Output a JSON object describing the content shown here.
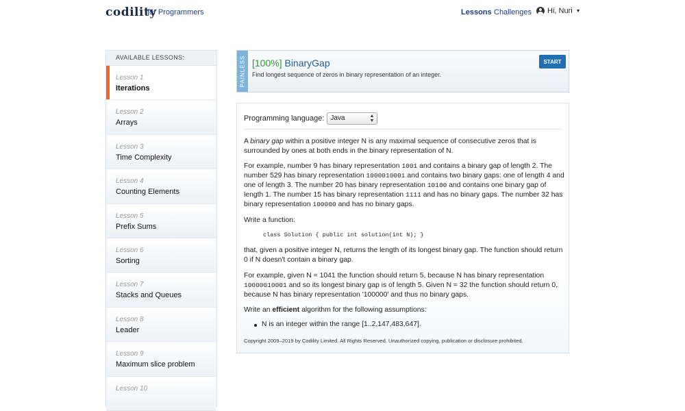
{
  "header": {
    "logo": "codility",
    "logo_sub": "for Programmers",
    "nav": {
      "lessons": "Lessons",
      "challenges": "Challenges"
    },
    "user": "Hi, Nuri"
  },
  "sidebar": {
    "header": "AVAILABLE LESSONS:",
    "items": [
      {
        "num": "Lesson 1",
        "title": "Iterations"
      },
      {
        "num": "Lesson 2",
        "title": "Arrays"
      },
      {
        "num": "Lesson 3",
        "title": "Time Complexity"
      },
      {
        "num": "Lesson 4",
        "title": "Counting Elements"
      },
      {
        "num": "Lesson 5",
        "title": "Prefix Sums"
      },
      {
        "num": "Lesson 6",
        "title": "Sorting"
      },
      {
        "num": "Lesson 7",
        "title": "Stacks and Queues"
      },
      {
        "num": "Lesson 8",
        "title": "Leader"
      },
      {
        "num": "Lesson 9",
        "title": "Maximum slice problem"
      },
      {
        "num": "Lesson 10",
        "title": ""
      }
    ]
  },
  "task": {
    "difficulty": "PAINLESS",
    "score": "[100%]",
    "name": "BinaryGap",
    "description": "Find longest sequence of zeros in binary representation of an integer.",
    "start_label": "START"
  },
  "content": {
    "language_label": "Programming language:",
    "language_value": "Java",
    "p1_a": "A ",
    "p1_em": "binary gap",
    "p1_b": " within a positive integer N is any maximal sequence of consecutive zeros that is surrounded by ones at both ends in the binary representation of N.",
    "p2_a": "For example, number 9 has binary representation ",
    "p2_c1": "1001",
    "p2_b": " and contains a binary gap of length 2. The number 529 has binary representation ",
    "p2_c2": "1000010001",
    "p2_c": " and contains two binary gaps: one of length 4 and one of length 3. The number 20 has binary representation ",
    "p2_c3": "10100",
    "p2_d": " and contains one binary gap of length 1. The number 15 has binary representation ",
    "p2_c4": "1111",
    "p2_e": " and has no binary gaps. The number 32 has binary representation ",
    "p2_c5": "100000",
    "p2_f": " and has no binary gaps.",
    "p3": "Write a function:",
    "code": "class Solution { public int solution(int N); }",
    "p4": "that, given a positive integer N, returns the length of its longest binary gap. The function should return 0 if N doesn't contain a binary gap.",
    "p5_a": "For example, given N = 1041 the function should return 5, because N has binary representation ",
    "p5_c1": "10000010001",
    "p5_b": " and so its longest binary gap is of length 5. Given N = 32 the function should return 0, because N has binary representation '100000' and thus no binary gaps.",
    "p6_a": "Write an ",
    "p6_strong": "efficient",
    "p6_b": " algorithm for the following assumptions:",
    "bullet": "N is an integer within the range [1..2,147,483,647].",
    "copyright": "Copyright 2009–2019 by Codility Limited. All Rights Reserved. Unauthorized copying, publication or disclosure prohibited."
  }
}
